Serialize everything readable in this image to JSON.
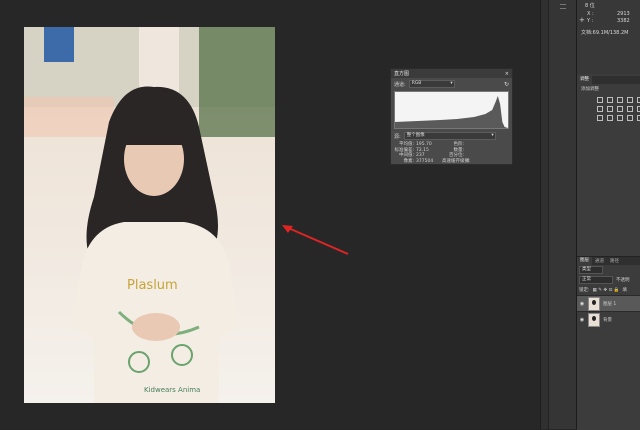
{
  "histogram_panel": {
    "title": "直方图",
    "close_icon": "×",
    "menu_icon": "≡",
    "channel_label": "通道:",
    "channel_value": "RGB",
    "source_label": "源:",
    "source_value": "整个图像",
    "stats": [
      {
        "key": "平均值:",
        "value": "195.70",
        "key2": "色阶:",
        "value2": ""
      },
      {
        "key": "标准偏差:",
        "value": "72.15",
        "key2": "数量:",
        "value2": ""
      },
      {
        "key": "中间值:",
        "value": "237",
        "key2": "百分位:",
        "value2": ""
      },
      {
        "key": "像素:",
        "value": "377504",
        "key2": "高速缓存级别:",
        "value2": "4"
      }
    ]
  },
  "info_panel": {
    "line1": "8 位",
    "x_label": "X :",
    "x_value": "2913",
    "y_label": "Y :",
    "y_value": "3382",
    "doc_size": "文档:69.1M/138.2M"
  },
  "adjust_panel": {
    "tab": "调整",
    "subtitle": "添加调整"
  },
  "layers_panel": {
    "tabs": [
      "图层",
      "通道",
      "路径"
    ],
    "kind_label": "类型",
    "blend_mode": "正常",
    "opacity_label": "不透明",
    "lock_label": "锁定:",
    "fill_label": "填",
    "layers": [
      {
        "name": "图层 1",
        "selected": true
      },
      {
        "name": "背景",
        "selected": false
      }
    ]
  }
}
